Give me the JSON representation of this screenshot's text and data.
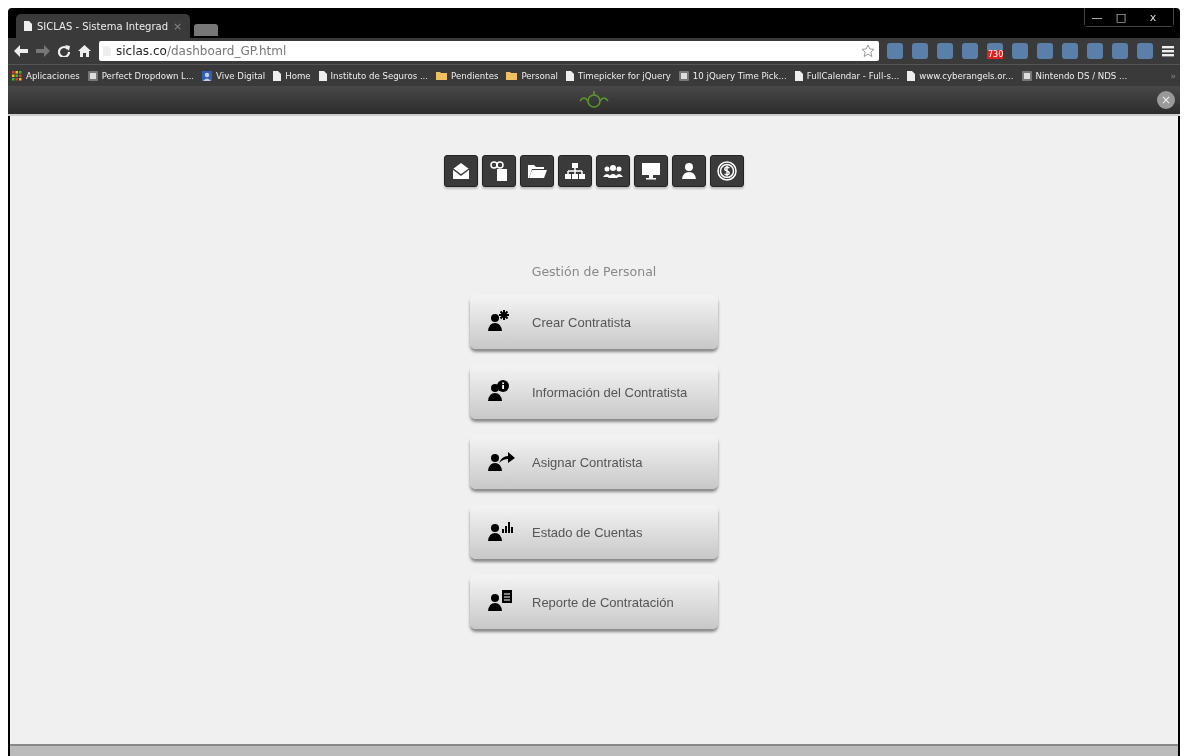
{
  "tab": {
    "title": "SICLAS - Sistema Integrad",
    "close": "×"
  },
  "window_controls": {
    "minimize": "—",
    "maximize": "□",
    "close": "x"
  },
  "address_bar": {
    "host": "siclas.co",
    "path": "/dashboard_GP.html"
  },
  "extensions": [
    {
      "kind": "plain"
    },
    {
      "kind": "plain"
    },
    {
      "kind": "plain"
    },
    {
      "kind": "plain"
    },
    {
      "kind": "badge",
      "badge": "730"
    },
    {
      "kind": "plain"
    },
    {
      "kind": "plain"
    },
    {
      "kind": "plain"
    },
    {
      "kind": "plain"
    },
    {
      "kind": "plain"
    },
    {
      "kind": "plain"
    }
  ],
  "bookmarks": [
    {
      "kind": "apps",
      "label": "Aplicaciones"
    },
    {
      "kind": "site",
      "label": "Perfect Dropdown L..."
    },
    {
      "kind": "person",
      "label": "Vive Digital"
    },
    {
      "kind": "page",
      "label": "Home"
    },
    {
      "kind": "page",
      "label": "Instituto de Seguros ..."
    },
    {
      "kind": "folder",
      "label": "Pendientes"
    },
    {
      "kind": "folder",
      "label": "Personal"
    },
    {
      "kind": "page",
      "label": "Timepicker for jQuery"
    },
    {
      "kind": "site",
      "label": "10 jQuery Time Pick..."
    },
    {
      "kind": "page",
      "label": "FullCalendar - Full-s..."
    },
    {
      "kind": "page",
      "label": "www.cyberangels.or..."
    },
    {
      "kind": "site",
      "label": "Nintendo DS / NDS ..."
    }
  ],
  "bookmarks_more": "»",
  "header": {
    "close": "×"
  },
  "module_icons": [
    {
      "kind": "mail"
    },
    {
      "kind": "gears"
    },
    {
      "kind": "folder"
    },
    {
      "kind": "org"
    },
    {
      "kind": "group"
    },
    {
      "kind": "monitor"
    },
    {
      "kind": "person"
    },
    {
      "kind": "money"
    }
  ],
  "section_title": "Gestión de Personal",
  "actions": [
    {
      "kind": "create",
      "label": "Crear Contratista"
    },
    {
      "kind": "info",
      "label": "Información del Contratista"
    },
    {
      "kind": "assign",
      "label": "Asignar Contratista"
    },
    {
      "kind": "chart",
      "label": "Estado de Cuentas"
    },
    {
      "kind": "report",
      "label": "Reporte de Contratación"
    }
  ]
}
